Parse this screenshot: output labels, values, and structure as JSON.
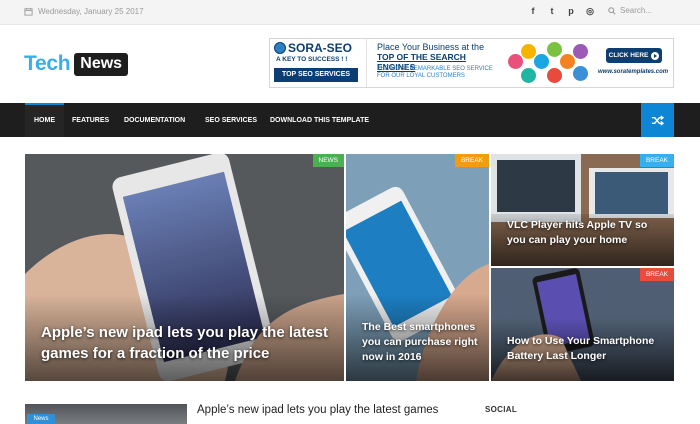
{
  "topbar": {
    "date": "Wednesday, January 25 2017",
    "socials": [
      {
        "icon": "facebook-icon",
        "glyph": "f"
      },
      {
        "icon": "twitter-icon",
        "glyph": "t"
      },
      {
        "icon": "pinterest-icon",
        "glyph": "p"
      },
      {
        "icon": "instagram-icon",
        "glyph": "◎"
      }
    ],
    "search_placeholder": "Search..."
  },
  "logo": {
    "tech": "Tech",
    "news": "News"
  },
  "banner": {
    "brand": "SORA-SEO",
    "key": "A KEY TO SUCCESS ! !",
    "services": "TOP SEO SERVICES",
    "place": "Place Your Business at the",
    "top": "TOP OF THE SEARCH ENGINES",
    "remark": "THE MOST REMARKABLE SEO SERVICE FOR OUR LOYAL CUSTOMERS",
    "click": "CLICK HERE",
    "url": "www.soratemplates.com"
  },
  "nav": {
    "items": [
      "HOME",
      "FEATURES",
      "DOCUMENTATION",
      "SEO SERVICES",
      "DOWNLOAD THIS TEMPLATE"
    ],
    "shuffle_icon": "shuffle-icon",
    "accent": "#0d87d5"
  },
  "featured": [
    {
      "tag": "NEWS",
      "tag_color": "#4caf50",
      "title": "Apple’s new ipad lets you play the latest games for a fraction of the price"
    },
    {
      "tag": "BREAK",
      "tag_color": "#f39c12",
      "title": "The Best smartphones you can purchase right now in 2016"
    },
    {
      "tag": "BREAK",
      "tag_color": "#3aaee8",
      "title": "VLC Player hits Apple TV so you can play your home"
    },
    {
      "tag": "BREAK",
      "tag_color": "#e74c3c",
      "title": "How to Use Your Smartphone Battery Last Longer"
    }
  ],
  "bottom": {
    "badge": "News",
    "title": "Apple’s new ipad lets you play the latest games",
    "social_heading": "SOCIAL"
  }
}
